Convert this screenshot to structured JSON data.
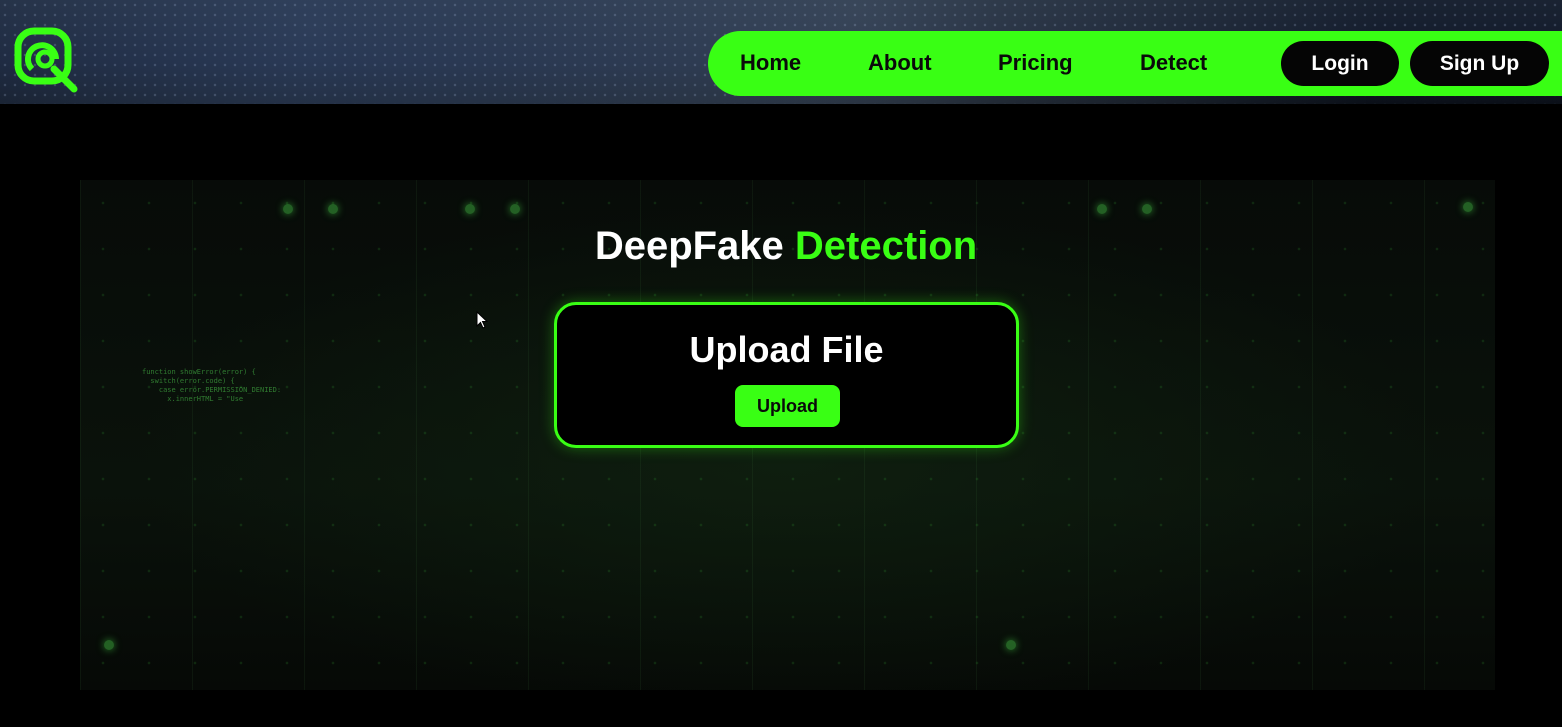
{
  "header": {
    "logo_icon": "deepfake-search-logo-icon",
    "nav": {
      "home": "Home",
      "about": "About",
      "pricing": "Pricing",
      "detect": "Detect",
      "login": "Login",
      "signup": "Sign Up"
    }
  },
  "main": {
    "title_prefix": "DeepFake",
    "title_accent": "Detection",
    "upload_card": {
      "title": "Upload File",
      "button_label": "Upload"
    }
  },
  "colors": {
    "accent": "#39ff14",
    "background": "#000000",
    "pill": "#050505",
    "text": "#ffffff"
  }
}
